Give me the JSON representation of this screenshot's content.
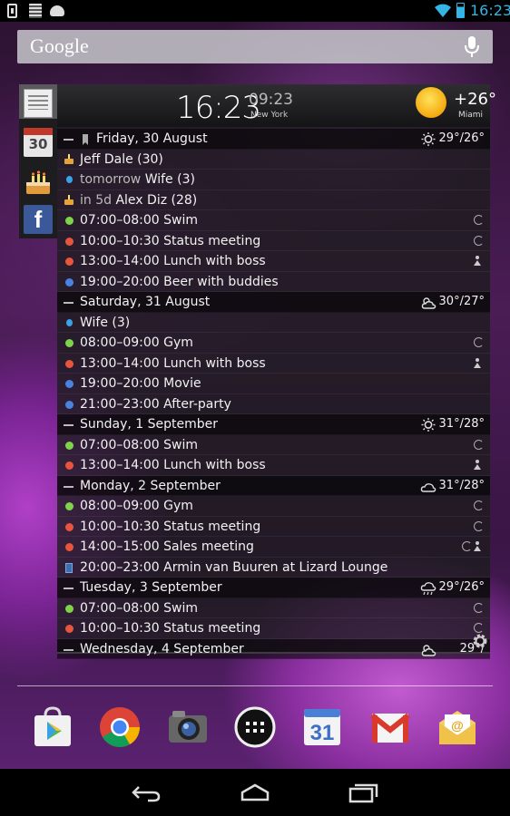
{
  "status_bar": {
    "time": "16:23"
  },
  "search": {
    "logo": "Google"
  },
  "side_tabs": {
    "calendar_day": "30",
    "facebook": "f"
  },
  "widget": {
    "clock_main": "16:23",
    "clock_secondary": "09:23",
    "clock_secondary_city": "New York",
    "weather_temp": "+26°",
    "weather_city": "Miami"
  },
  "agenda": [
    {
      "kind": "day",
      "label": "Friday, 30 August",
      "temp": "29°/26°",
      "weather": "sun-icon",
      "bookmark": true
    },
    {
      "kind": "birthday",
      "label": "Jeff Dale (30)"
    },
    {
      "kind": "contact",
      "prefix": "tomorrow",
      "label": "Wife (3)"
    },
    {
      "kind": "birthday",
      "prefix": "in 5d",
      "label": "Alex Diz (28)"
    },
    {
      "kind": "event",
      "color": "#7fd34a",
      "label": "07:00–08:00 Swim",
      "icons": [
        "repeat-icon"
      ]
    },
    {
      "kind": "event",
      "color": "#e8553c",
      "label": "10:00–10:30 Status meeting",
      "icons": [
        "repeat-icon"
      ]
    },
    {
      "kind": "event",
      "color": "#e8553c",
      "label": "13:00–14:00 Lunch with boss",
      "icons": [
        "people-icon"
      ]
    },
    {
      "kind": "event",
      "color": "#4a82e0",
      "label": "19:00–20:00 Beer with buddies",
      "icons": []
    },
    {
      "kind": "day",
      "label": "Saturday, 31 August",
      "temp": "30°/27°",
      "weather": "partly-cloudy-icon"
    },
    {
      "kind": "contact",
      "label": "Wife (3)"
    },
    {
      "kind": "event",
      "color": "#7fd34a",
      "label": "08:00–09:00 Gym",
      "icons": [
        "repeat-icon"
      ]
    },
    {
      "kind": "event",
      "color": "#e8553c",
      "label": "13:00–14:00 Lunch with boss",
      "icons": [
        "people-icon"
      ]
    },
    {
      "kind": "event",
      "color": "#4a82e0",
      "label": "19:00–20:00 Movie",
      "icons": []
    },
    {
      "kind": "event",
      "color": "#4a82e0",
      "label": "21:00–23:00 After-party",
      "icons": []
    },
    {
      "kind": "day",
      "label": "Sunday, 1 September",
      "temp": "31°/28°",
      "weather": "sun-icon"
    },
    {
      "kind": "event",
      "color": "#7fd34a",
      "label": "07:00–08:00 Swim",
      "icons": [
        "repeat-icon"
      ]
    },
    {
      "kind": "event",
      "color": "#e8553c",
      "label": "13:00–14:00 Lunch with boss",
      "icons": [
        "people-icon"
      ]
    },
    {
      "kind": "day",
      "label": "Monday, 2 September",
      "temp": "31°/28°",
      "weather": "cloud-icon"
    },
    {
      "kind": "event",
      "color": "#7fd34a",
      "label": "08:00–09:00 Gym",
      "icons": [
        "repeat-icon"
      ]
    },
    {
      "kind": "event",
      "color": "#e8553c",
      "label": "10:00–10:30 Status meeting",
      "icons": [
        "repeat-icon"
      ]
    },
    {
      "kind": "event",
      "color": "#e8553c",
      "label": "14:00–15:00 Sales meeting",
      "icons": [
        "repeat-icon",
        "people-icon"
      ]
    },
    {
      "kind": "book",
      "label": "20:00–23:00 Armin van Buuren at Lizard Lounge",
      "icons": []
    },
    {
      "kind": "day",
      "label": "Tuesday, 3 September",
      "temp": "29°/26°",
      "weather": "rain-icon"
    },
    {
      "kind": "event",
      "color": "#7fd34a",
      "label": "07:00–08:00 Swim",
      "icons": [
        "repeat-icon"
      ]
    },
    {
      "kind": "event",
      "color": "#e8553c",
      "label": "10:00–10:30 Status meeting",
      "icons": [
        "repeat-icon"
      ]
    },
    {
      "kind": "day",
      "label": "Wednesday, 4 September",
      "temp": "29°/",
      "weather": "partly-cloudy-icon"
    }
  ],
  "dock": {
    "play_store": "play-store-icon",
    "chrome": "chrome-icon",
    "camera": "camera-icon",
    "app_drawer": "app-drawer-icon",
    "calendar": "calendar-icon",
    "calendar_day": "31",
    "gmail": "gmail-icon",
    "email": "email-icon"
  }
}
